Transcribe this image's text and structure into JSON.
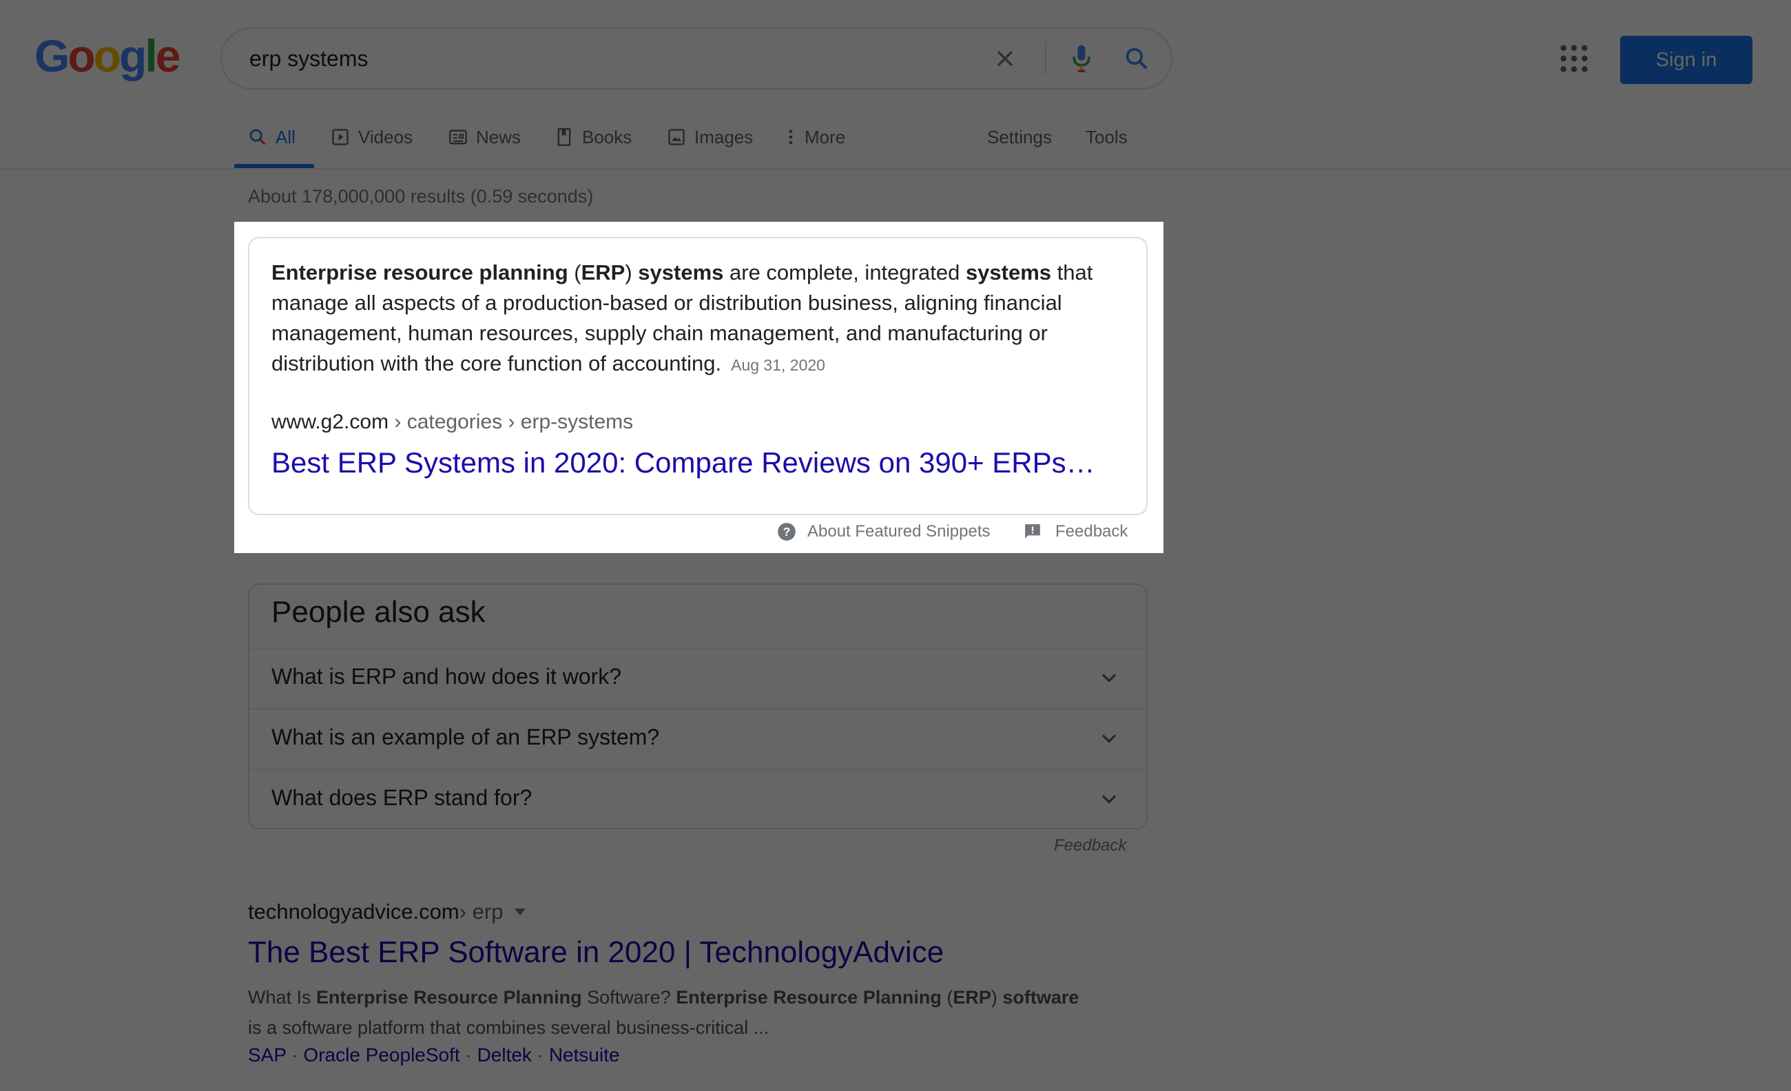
{
  "header": {
    "search_query": "erp systems",
    "clear_icon": "close-icon",
    "voice_icon": "microphone-icon",
    "search_icon": "search-icon",
    "apps_icon": "apps-grid-icon",
    "sign_in_label": "Sign in"
  },
  "tabs": [
    {
      "label": "All",
      "icon": "search-icon",
      "active": true
    },
    {
      "label": "Videos",
      "icon": "play-icon"
    },
    {
      "label": "News",
      "icon": "newspaper-icon"
    },
    {
      "label": "Books",
      "icon": "book-icon"
    },
    {
      "label": "Images",
      "icon": "image-icon"
    },
    {
      "label": "More",
      "icon": "more-vertical-icon"
    }
  ],
  "tools": {
    "settings": "Settings",
    "tools": "Tools"
  },
  "stats": "About 178,000,000 results (0.59 seconds)",
  "featured_snippet": {
    "text_parts": {
      "p1": "Enterprise resource planning",
      "p2": " (",
      "p3": "ERP",
      "p4": ") ",
      "p5": "systems",
      "p6": " are complete, integrated ",
      "p7": "systems",
      "p8": " that manage all aspects of a production-based or distribution business, aligning financial management, human resources, supply chain management, and manufacturing or distribution with the core function of accounting."
    },
    "date": "Aug 31, 2020",
    "cite_domain": "www.g2.com",
    "cite_path": " › categories › erp-systems",
    "title": "Best ERP Systems in 2020: Compare Reviews on 390+ ERPs…",
    "about_label": "About Featured Snippets",
    "feedback_label": "Feedback"
  },
  "people_also_ask": {
    "title": "People also ask",
    "questions": [
      "What is ERP and how does it work?",
      "What is an example of an ERP system?",
      "What does ERP stand for?"
    ],
    "feedback_label": "Feedback"
  },
  "result": {
    "cite_domain": "technologyadvice.com",
    "cite_path": " › erp",
    "title": "The Best ERP Software in 2020 | TechnologyAdvice",
    "snippet_parts": {
      "s1": "What Is ",
      "s2": "Enterprise Resource Planning",
      "s3": " Software? ",
      "s4": "Enterprise Resource Planning",
      "s5": " (",
      "s6": "ERP",
      "s7": ") ",
      "s8": "software",
      "s9": " is a software platform that combines several business-critical ..."
    },
    "sitelinks": [
      "SAP",
      "Oracle PeopleSoft",
      "Deltek",
      "Netsuite"
    ],
    "separator": " · "
  },
  "colors": {
    "link": "#1a0dab",
    "accent": "#1a73e8",
    "overlay": "rgba(0,0,0,0.6)"
  }
}
